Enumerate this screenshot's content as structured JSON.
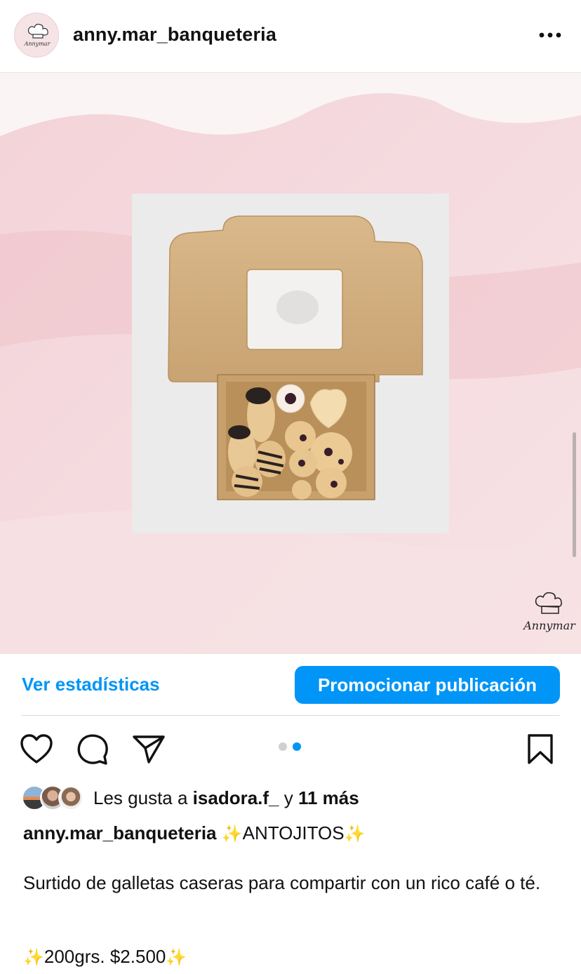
{
  "post": {
    "username": "anny.mar_banqueteria",
    "avatar_brand": "Annymar",
    "watermark_brand": "Annymar"
  },
  "actions": {
    "stats_label": "Ver estadísticas",
    "promote_label": "Promocionar publicación"
  },
  "carousel": {
    "total": 2,
    "active_index": 1
  },
  "likes": {
    "prefix": "Les gusta a",
    "user": "isadora.f_",
    "conjunction": "y",
    "others": "11 más"
  },
  "caption": {
    "username": "anny.mar_banqueteria",
    "title": "ANTOJITOS",
    "line1": "Surtido de galletas caseras para compartir con un rico café o té.",
    "price": "200grs. $2.500"
  },
  "colors": {
    "accent": "#0095f6",
    "text": "#111111",
    "separator": "#dbdbdb"
  },
  "icons": [
    "more-horizontal-icon",
    "heart-icon",
    "comment-icon",
    "share-icon",
    "bookmark-icon",
    "sparkles-icon",
    "chef-hat-icon"
  ]
}
